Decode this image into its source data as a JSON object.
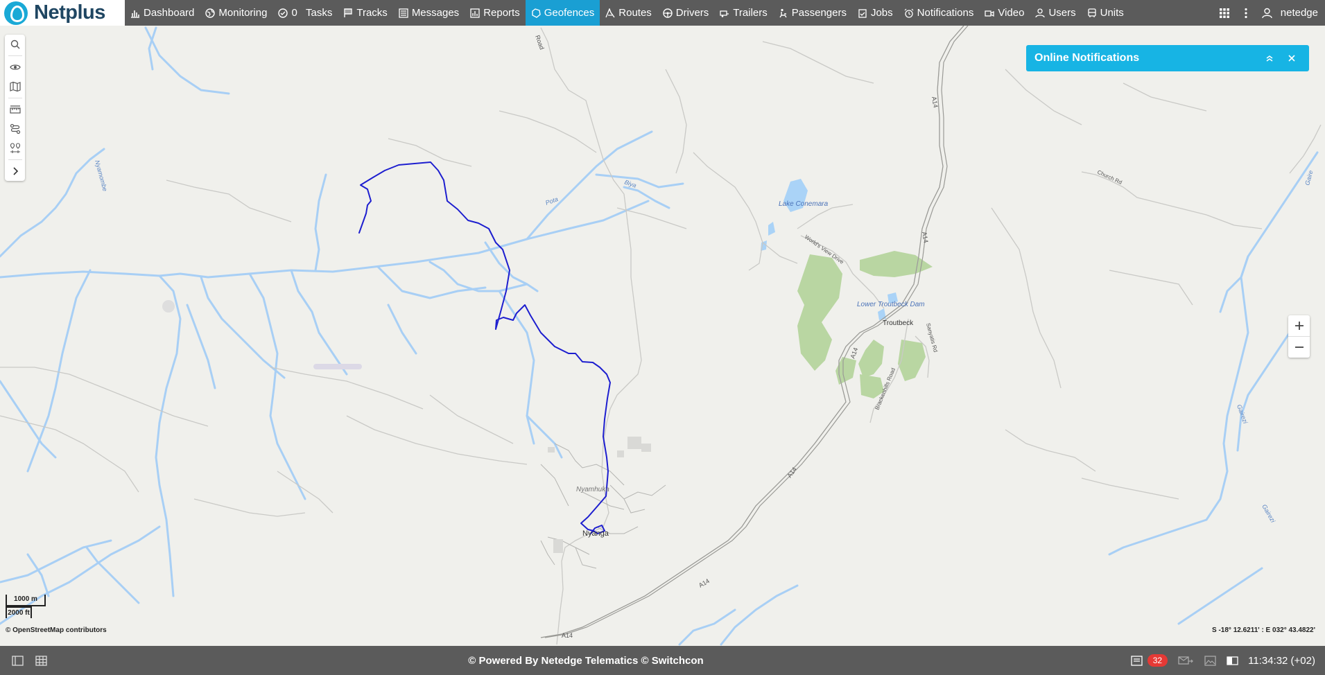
{
  "brand": {
    "name": "Netplus"
  },
  "nav": {
    "items": [
      {
        "label": "Dashboard",
        "icon": "bar-chart-icon"
      },
      {
        "label": "Monitoring",
        "icon": "globe-icon"
      },
      {
        "label": "0   Tasks",
        "icon": "check-circle-icon"
      },
      {
        "label": "Tracks",
        "icon": "flag-icon"
      },
      {
        "label": "Messages",
        "icon": "message-list-icon"
      },
      {
        "label": "Reports",
        "icon": "report-icon"
      },
      {
        "label": "Geofences",
        "icon": "geofence-icon",
        "active": true
      },
      {
        "label": "Routes",
        "icon": "route-icon"
      },
      {
        "label": "Drivers",
        "icon": "steering-wheel-icon"
      },
      {
        "label": "Trailers",
        "icon": "trailer-icon"
      },
      {
        "label": "Passengers",
        "icon": "passenger-icon"
      },
      {
        "label": "Jobs",
        "icon": "clipboard-check-icon"
      },
      {
        "label": "Notifications",
        "icon": "alarm-icon"
      },
      {
        "label": "Video",
        "icon": "video-icon"
      },
      {
        "label": "Users",
        "icon": "user-icon"
      },
      {
        "label": "Units",
        "icon": "bus-icon"
      }
    ],
    "user": "netedge"
  },
  "notifications_panel": {
    "title": "Online Notifications"
  },
  "map": {
    "labels": {
      "lake_conemara": "Lake Conemara",
      "lower_troutbeck_dam": "Lower Troutbeck Dam",
      "troutbeck": "Troutbeck",
      "nyamhuka": "Nyamhuka",
      "nyanga": "Nyanga",
      "a14": "A14",
      "worlds_view_drive": "World's View Drive",
      "church_rd": "Church Rd",
      "brackenhills_road": "Brackenhills Road",
      "sanyatis_rd": "Sanyatis Rd",
      "road": "Road",
      "biya": "Biya",
      "pota": "Pota",
      "nyamombe": "Nyamombe",
      "gairezi": "Gairezi",
      "gairezi2": "Gairezi",
      "gaire": "Gaire"
    },
    "scale_metric": "1000 m",
    "scale_imperial": "2000 ft",
    "attribution": "© OpenStreetMap contributors",
    "coordinates": "S -18° 12.6211' : E 032° 43.4822'"
  },
  "footer": {
    "powered": "© Powered By Netedge Telematics © Switchcon",
    "message_count": "32",
    "time": "11:34:32 (+02)"
  }
}
